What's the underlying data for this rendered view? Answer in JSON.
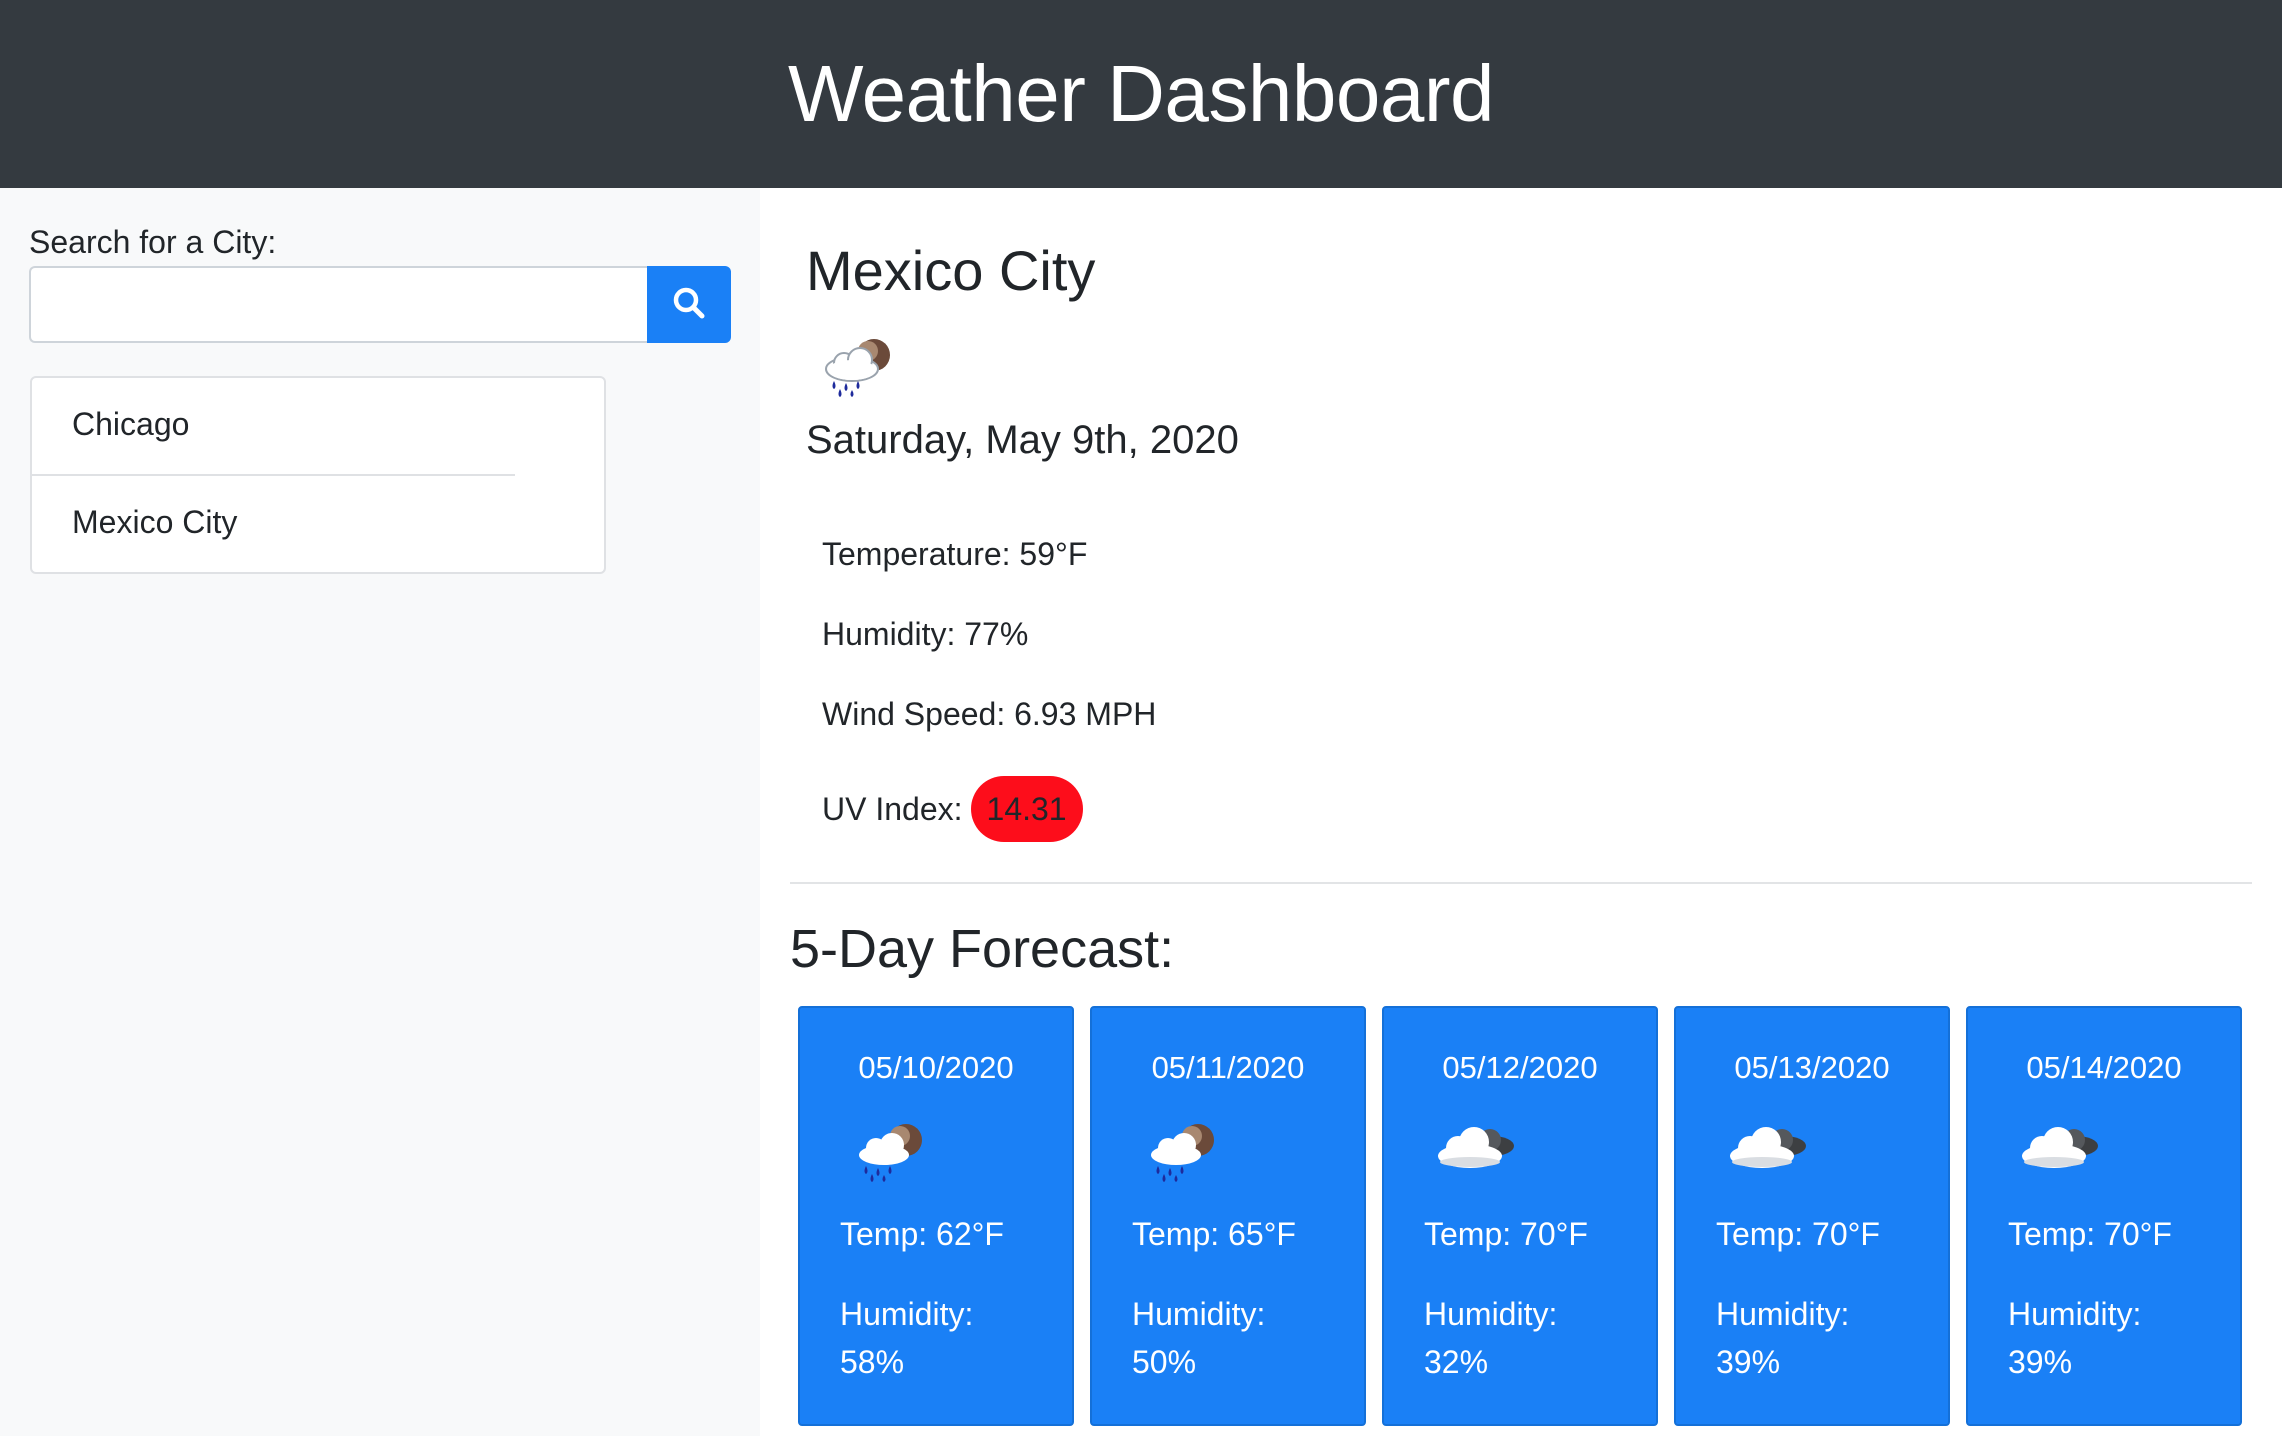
{
  "header": {
    "title": "Weather Dashboard"
  },
  "sidebar": {
    "search_label": "Search for a City:",
    "search_value": "",
    "search_placeholder": "",
    "search_icon": "magnifying-glass",
    "cities": [
      "Chicago",
      "Mexico City"
    ]
  },
  "current": {
    "city": "Mexico City",
    "icon": "rain-cloud",
    "date": "Saturday, May 9th, 2020",
    "temperature": "Temperature: 59°F",
    "humidity": "Humidity: 77%",
    "wind": "Wind Speed: 6.93 MPH",
    "uv_label": "UV Index:",
    "uv_value": "14.31",
    "uv_color": "#fd0d1b"
  },
  "forecast": {
    "title": "5-Day Forecast:",
    "days": [
      {
        "date": "05/10/2020",
        "icon": "rain-cloud",
        "temp": "Temp: 62°F",
        "humidity_label": "Humidity:",
        "humidity": "58%"
      },
      {
        "date": "05/11/2020",
        "icon": "rain-cloud",
        "temp": "Temp: 65°F",
        "humidity_label": "Humidity:",
        "humidity": "50%"
      },
      {
        "date": "05/12/2020",
        "icon": "cloud",
        "temp": "Temp: 70°F",
        "humidity_label": "Humidity:",
        "humidity": "32%"
      },
      {
        "date": "05/13/2020",
        "icon": "cloud",
        "temp": "Temp: 70°F",
        "humidity_label": "Humidity:",
        "humidity": "39%"
      },
      {
        "date": "05/14/2020",
        "icon": "cloud",
        "temp": "Temp: 70°F",
        "humidity_label": "Humidity:",
        "humidity": "39%"
      }
    ]
  },
  "colors": {
    "header_bg": "#343a40",
    "primary": "#1a80f6",
    "sidebar_bg": "#f8f9fa"
  }
}
